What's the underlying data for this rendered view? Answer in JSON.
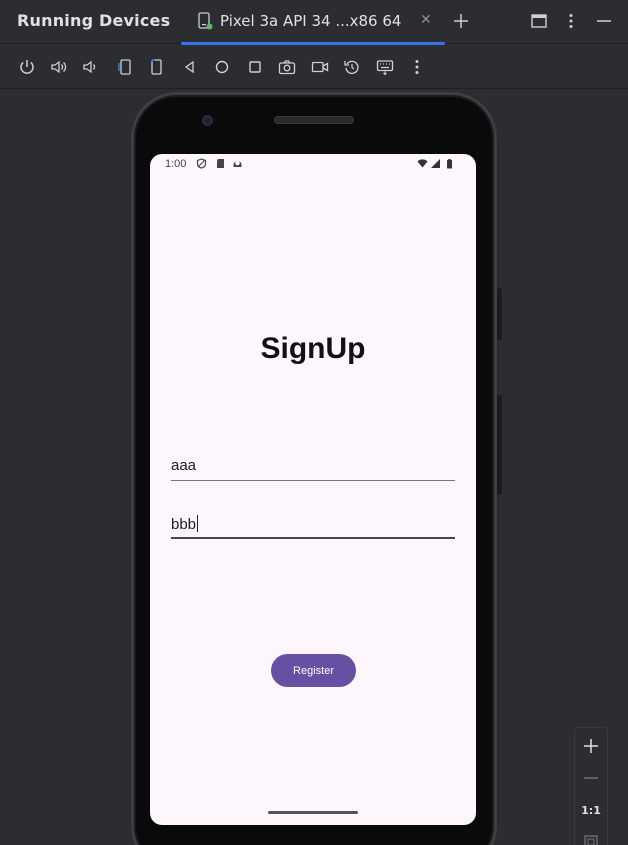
{
  "panel": {
    "title": "Running Devices"
  },
  "tab": {
    "label": "Pixel 3a API 34 ...x86 64",
    "close_glyph": "✕"
  },
  "title_actions": [
    "add-tab",
    "restore-layout",
    "more-options",
    "minimize"
  ],
  "toolbar": [
    "power",
    "volume-up",
    "volume-down",
    "rotate-left",
    "rotate-right",
    "back",
    "home",
    "overview",
    "screenshot",
    "screen-record",
    "reset-orientation",
    "keyboard",
    "more-options"
  ],
  "device": {
    "status_time": "1:00",
    "app_title": "SignUp",
    "field1_value": "aaa",
    "field2_value": "bbb",
    "register_label": "Register"
  },
  "zoom": {
    "plus": "+",
    "minus": "—",
    "actual_size": "1:1"
  },
  "colors": {
    "accent": "#3574f0",
    "button": "#6750a4",
    "screen_bg": "#fdf6fd",
    "ide_bg": "#2b2d30"
  }
}
